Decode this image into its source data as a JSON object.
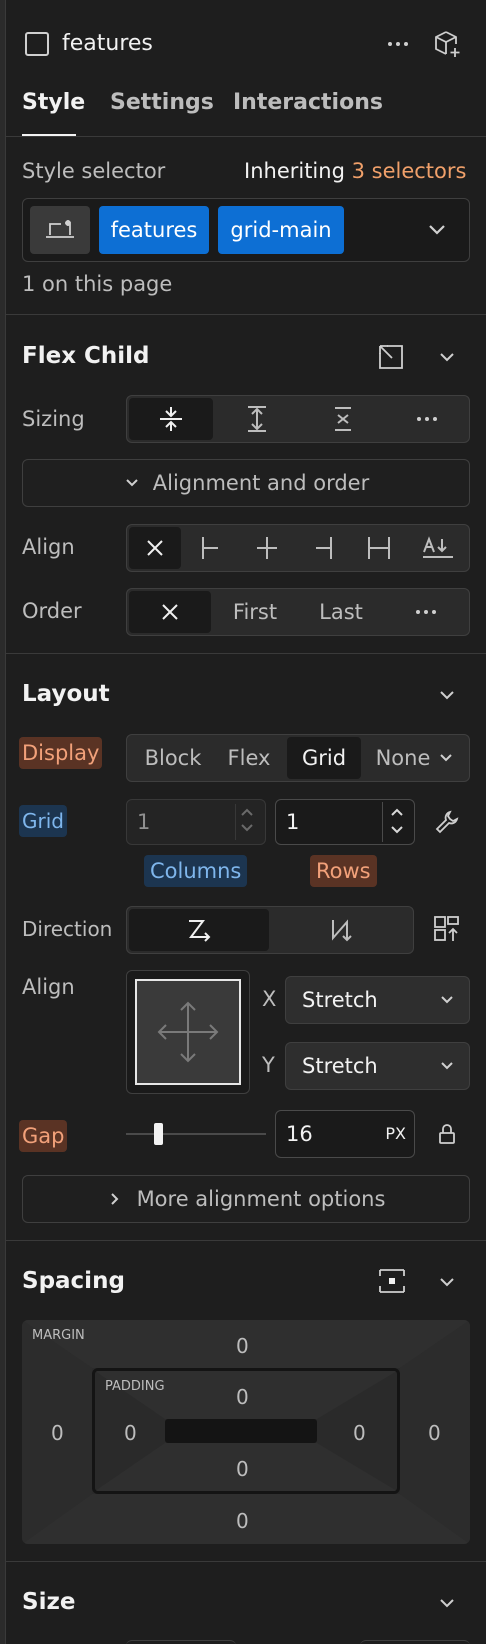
{
  "header": {
    "element_name": "features",
    "more_icon": "more-horizontal-icon",
    "component_icon": "add-component-icon"
  },
  "tabs": [
    {
      "label": "Style",
      "active": true
    },
    {
      "label": "Settings",
      "active": false
    },
    {
      "label": "Interactions",
      "active": false
    }
  ],
  "style_selector": {
    "label": "Style selector",
    "inheriting_prefix": "Inheriting",
    "inheriting_count": "3 selectors",
    "chips": [
      "features",
      "grid-main"
    ],
    "usage": "1 on this page"
  },
  "flex_child": {
    "title": "Flex Child",
    "sizing_label": "Sizing",
    "alignment_toggle": "Alignment and order",
    "align_label": "Align",
    "order_label": "Order",
    "order_options": [
      "First",
      "Last"
    ]
  },
  "layout": {
    "title": "Layout",
    "display_label": "Display",
    "display_options": [
      "Block",
      "Flex",
      "Grid",
      "None"
    ],
    "display_active": "Grid",
    "grid_label": "Grid",
    "columns_value": "1",
    "rows_value": "1",
    "columns_label": "Columns",
    "rows_label": "Rows",
    "direction_label": "Direction",
    "align_label": "Align",
    "align_x_label": "X",
    "align_x_value": "Stretch",
    "align_y_label": "Y",
    "align_y_value": "Stretch",
    "gap_label": "Gap",
    "gap_value": "16",
    "gap_unit": "PX",
    "gap_slider_fraction": 0.21,
    "more_alignment": "More alignment options"
  },
  "spacing": {
    "title": "Spacing",
    "margin_label": "MARGIN",
    "padding_label": "PADDING",
    "margin": {
      "top": "0",
      "right": "0",
      "bottom": "0",
      "left": "0"
    },
    "padding": {
      "top": "0",
      "right": "0",
      "bottom": "0",
      "left": "0"
    }
  },
  "size": {
    "title": "Size"
  },
  "colors": {
    "accent_blue": "#0d6fd4",
    "inherit_orange": "#f0a06a",
    "panel_bg": "#1e1e1e"
  }
}
